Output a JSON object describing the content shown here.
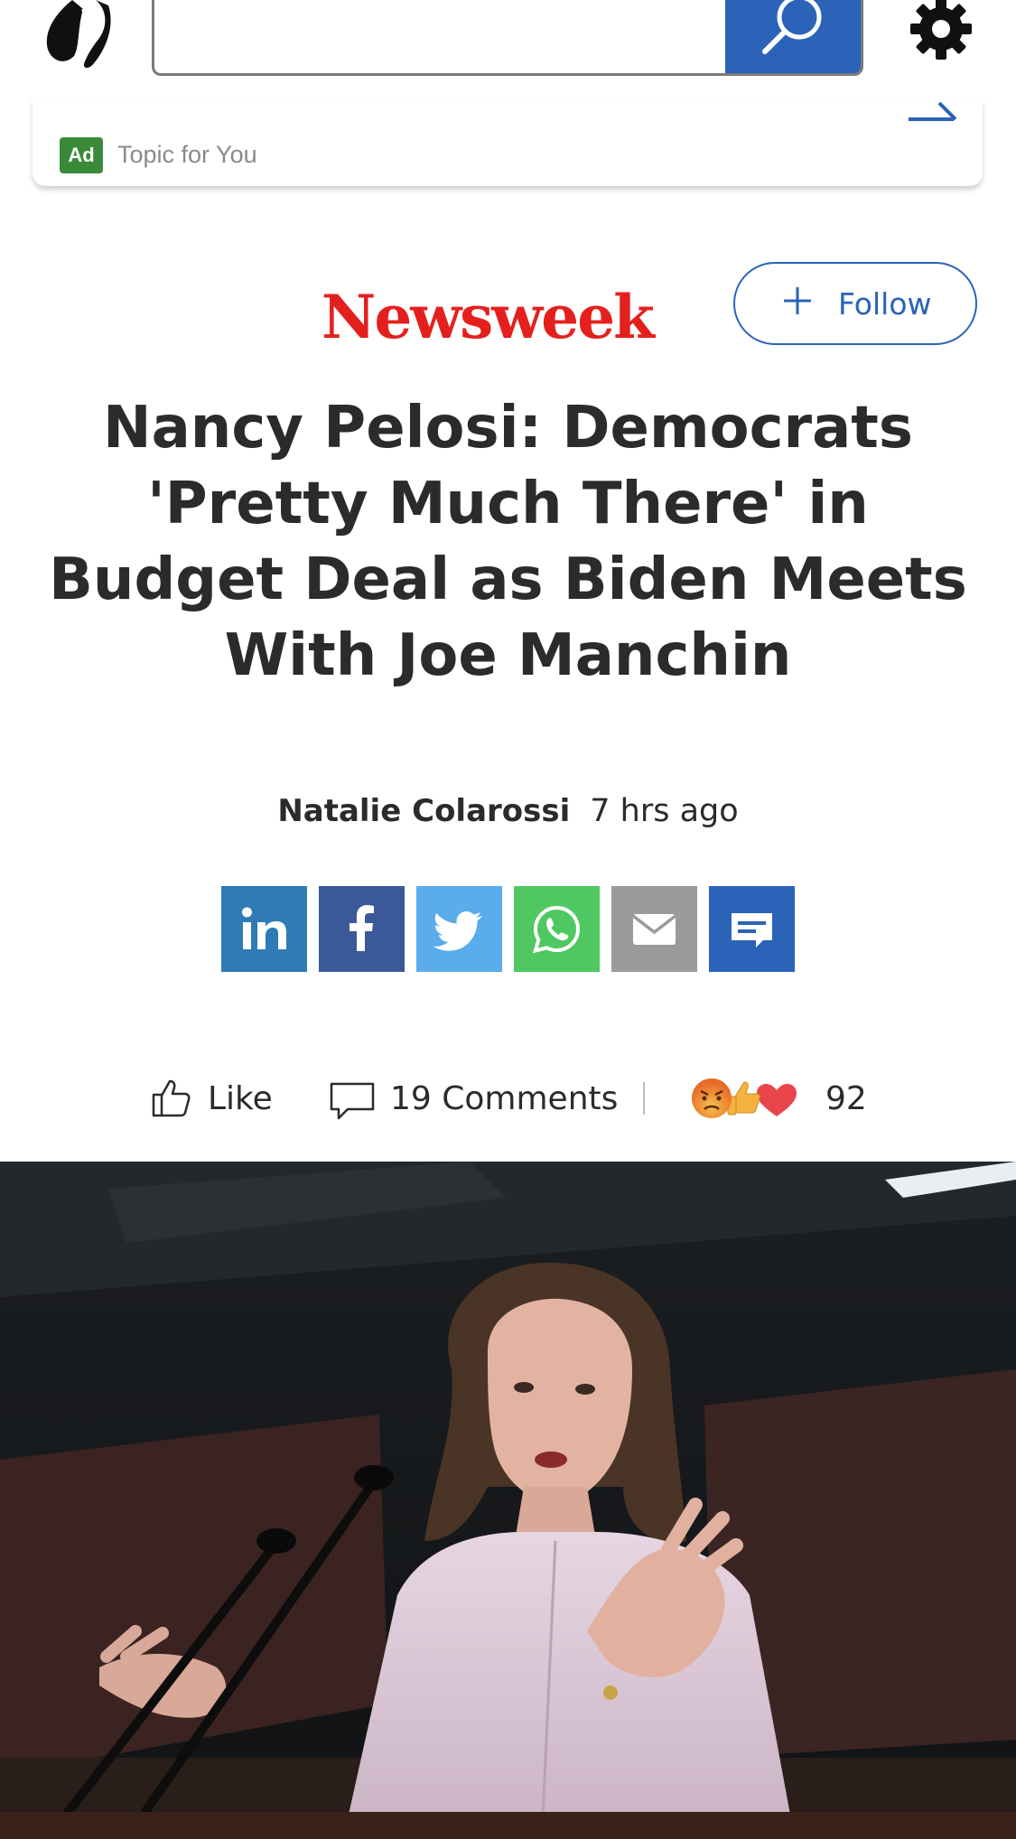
{
  "header": {
    "logo_icon": "butterfly-icon",
    "search": {
      "value": "",
      "placeholder": "",
      "button_icon": "search-icon"
    },
    "settings_icon": "gear-icon",
    "accent": "#2a63b8"
  },
  "ad": {
    "badge": "Ad",
    "topic": "Topic for You",
    "arrow_icon": "arrow-right-icon",
    "badge_color": "#3a8a3a"
  },
  "article": {
    "publisher": "Newsweek",
    "publisher_color": "#e4201f",
    "follow_label": "Follow",
    "headline": "Nancy Pelosi: Democrats 'Pretty Much There' in Budget Deal as Biden Meets With Joe Manchin",
    "author": "Natalie Colarossi",
    "time": "7 hrs ago"
  },
  "share": [
    {
      "name": "linkedin",
      "icon": "linkedin-icon",
      "color": "#2f7bb4"
    },
    {
      "name": "facebook",
      "icon": "facebook-icon",
      "color": "#3b5998"
    },
    {
      "name": "twitter",
      "icon": "twitter-icon",
      "color": "#5aacea"
    },
    {
      "name": "whatsapp",
      "icon": "whatsapp-icon",
      "color": "#4fc861"
    },
    {
      "name": "email",
      "icon": "mail-icon",
      "color": "#9b9b9b"
    },
    {
      "name": "comment",
      "icon": "comment-icon",
      "color": "#2a63b8"
    }
  ],
  "engagement": {
    "like_label": "Like",
    "comments_label": "19 Comments",
    "reaction_count": "92",
    "reaction_icons": [
      "angry-emoji-icon",
      "thumbs-up-emoji-icon",
      "heart-emoji-icon"
    ]
  },
  "photo": {
    "icon": "news-photo"
  }
}
